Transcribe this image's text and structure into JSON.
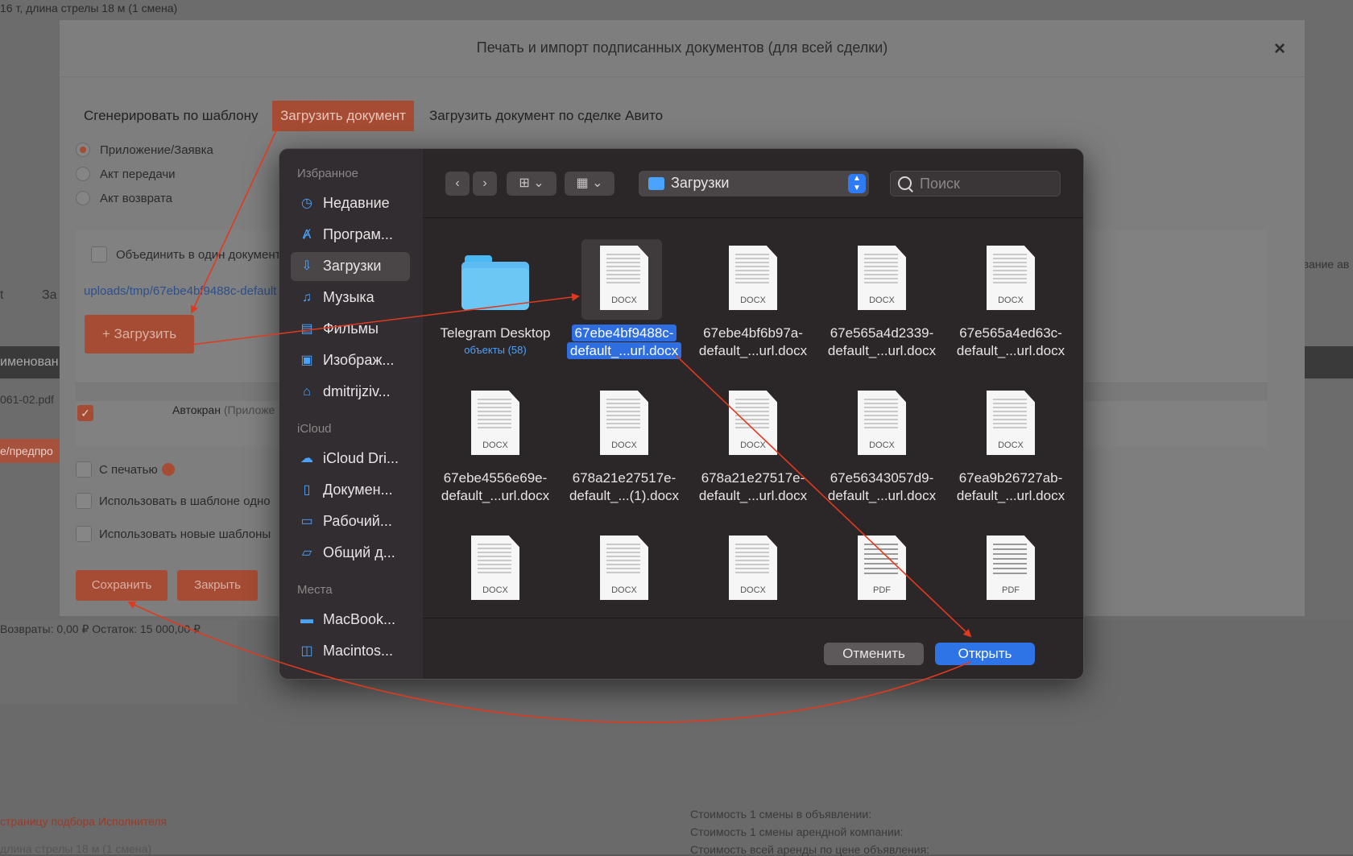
{
  "background": {
    "top_text": "16 т, длина стрелы 18 м (1 смена)",
    "left_fragments": [
      "t",
      "За"
    ],
    "dark_bar_text": "именован",
    "filename_fragment": "061-02.pdf",
    "red_tag": "е/предпро",
    "right_fragment": "ование ав",
    "returns_text": "Возвраты: 0,00 ₽   Остаток: 15 000,00 ₽",
    "select_executor_link": "страницу подбора Исполнителя",
    "bottom_small": "длина стрелы 18 м (1 смена)",
    "cost_lines": [
      "Стоимость 1 смены в объявлении:",
      "Стоимость 1 смены арендной компании:",
      "Стоимость всей аренды по цене объявления:"
    ]
  },
  "modal": {
    "title": "Печать и импорт подписанных документов (для всей сделки)",
    "close": "×",
    "tabs": [
      "Сгенерировать по шаблону",
      "Загрузить документ",
      "Загрузить документ по сделке Авито"
    ],
    "radios": [
      {
        "label": "Приложение/Заявка",
        "checked": true
      },
      {
        "label": "Акт передачи",
        "checked": false
      },
      {
        "label": "Акт возврата",
        "checked": false
      }
    ],
    "merge_label": "Объединить в один документ",
    "upload_path": "uploads/tmp/67ebe4bf9488c-default",
    "upload_button": "+ Загрузить",
    "row_text": "Автокран",
    "row_text_suffix": "(Приложе",
    "options": [
      "С печатью",
      "Использовать в шаблоне одно",
      "Использовать новые шаблоны"
    ],
    "save_button": "Сохранить",
    "close_button": "Закрыть"
  },
  "dialog": {
    "sidebar": {
      "favorites_title": "Избранное",
      "favorites": [
        {
          "icon": "clock-icon",
          "glyph": "◷",
          "label": "Недавние"
        },
        {
          "icon": "applications-icon",
          "glyph": "Ⱥ",
          "label": "Програм..."
        },
        {
          "icon": "downloads-icon",
          "glyph": "⇩",
          "label": "Загрузки",
          "selected": true
        },
        {
          "icon": "music-icon",
          "glyph": "♫",
          "label": "Музыка"
        },
        {
          "icon": "movies-icon",
          "glyph": "▤",
          "label": "Фильмы"
        },
        {
          "icon": "pictures-icon",
          "glyph": "▣",
          "label": "Изображ..."
        },
        {
          "icon": "home-icon",
          "glyph": "⌂",
          "label": "dmitrijziv..."
        }
      ],
      "icloud_title": "iCloud",
      "icloud": [
        {
          "icon": "cloud-icon",
          "glyph": "☁",
          "label": "iCloud Dri..."
        },
        {
          "icon": "document-icon",
          "glyph": "▯",
          "label": "Докумен..."
        },
        {
          "icon": "desktop-icon",
          "glyph": "▭",
          "label": "Рабочий..."
        },
        {
          "icon": "shared-folder-icon",
          "glyph": "▱",
          "label": "Общий д..."
        }
      ],
      "places_title": "Места",
      "places": [
        {
          "icon": "laptop-icon",
          "glyph": "▬",
          "label": "MacBook..."
        },
        {
          "icon": "disk-icon",
          "glyph": "◫",
          "label": "Macintos..."
        }
      ]
    },
    "toolbar": {
      "back": "‹",
      "forward": "›",
      "view_icons": "⊞ ⌄",
      "view_group": "▦ ⌄",
      "location": "Загрузки",
      "search_placeholder": "Поиск"
    },
    "files": [
      {
        "type": "folder",
        "line1": "Telegram Desktop",
        "line2": "",
        "sub": "объекты (58)"
      },
      {
        "type": "docx",
        "line1": "67ebe4bf9488c-",
        "line2": "default_...url.docx",
        "selected": true
      },
      {
        "type": "docx",
        "line1": "67ebe4bf6b97a-",
        "line2": "default_...url.docx"
      },
      {
        "type": "docx",
        "line1": "67e565a4d2339-",
        "line2": "default_...url.docx"
      },
      {
        "type": "docx",
        "line1": "67e565a4ed63c-",
        "line2": "default_...url.docx"
      },
      {
        "type": "docx",
        "line1": "67ebe4556e69e-",
        "line2": "default_...url.docx"
      },
      {
        "type": "docx",
        "line1": "678a21e27517e-",
        "line2": "default_...(1).docx"
      },
      {
        "type": "docx",
        "line1": "678a21e27517e-",
        "line2": "default_...url.docx"
      },
      {
        "type": "docx",
        "line1": "67e56343057d9-",
        "line2": "default_...url.docx"
      },
      {
        "type": "docx",
        "line1": "67ea9b26727ab-",
        "line2": "default_...url.docx"
      },
      {
        "type": "docx",
        "line1": "",
        "line2": ""
      },
      {
        "type": "docx",
        "line1": "",
        "line2": ""
      },
      {
        "type": "docx",
        "line1": "",
        "line2": ""
      },
      {
        "type": "pdf",
        "line1": "",
        "line2": ""
      },
      {
        "type": "pdf",
        "line1": "",
        "line2": ""
      }
    ],
    "docx_label": "DOCX",
    "pdf_label": "PDF",
    "cancel_button": "Отменить",
    "open_button": "Открыть"
  },
  "colors": {
    "accent_red": "#a64c34",
    "annotation_red": "#e03a1e",
    "mac_blue": "#2f74e6"
  }
}
